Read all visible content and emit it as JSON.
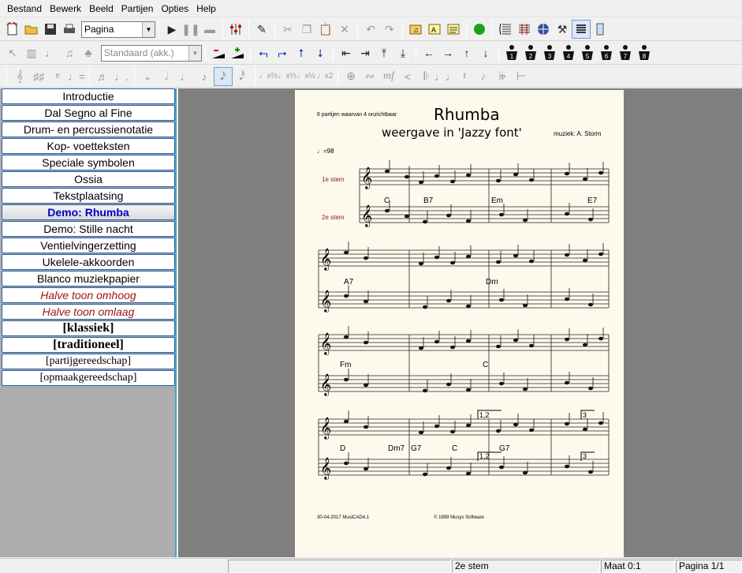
{
  "menu": [
    "Bestand",
    "Bewerk",
    "Beeld",
    "Partijen",
    "Opties",
    "Help"
  ],
  "toolbar": {
    "page_select": "Pagina",
    "style_select": "Standaard (akk.)",
    "figure_labels": [
      "1",
      "2",
      "3",
      "4",
      "5",
      "6",
      "7",
      "8"
    ]
  },
  "sidebar": {
    "items": [
      {
        "label": "Introductie",
        "style": "normal"
      },
      {
        "label": "Dal Segno al Fine",
        "style": "normal"
      },
      {
        "label": "Drum- en percussienotatie",
        "style": "normal"
      },
      {
        "label": "Kop- voetteksten",
        "style": "normal"
      },
      {
        "label": "Speciale symbolen",
        "style": "normal"
      },
      {
        "label": "Ossia",
        "style": "normal"
      },
      {
        "label": "Tekstplaatsing",
        "style": "normal"
      },
      {
        "label": "Demo: Rhumba",
        "style": "active"
      },
      {
        "label": "Demo: Stille nacht",
        "style": "normal"
      },
      {
        "label": "Ventielvingerzetting",
        "style": "normal"
      },
      {
        "label": "Ukelele-akkoorden",
        "style": "normal"
      },
      {
        "label": "Blanco muziekpapier",
        "style": "normal"
      },
      {
        "label": "Halve toon omhoog",
        "style": "red"
      },
      {
        "label": "Halve toon omlaag",
        "style": "red"
      },
      {
        "label": "[klassiek]",
        "style": "bold"
      },
      {
        "label": "[traditioneel]",
        "style": "bold"
      },
      {
        "label": "[partijgereedschap]",
        "style": "serif"
      },
      {
        "label": "[opmaakgereedschap]",
        "style": "serif"
      }
    ]
  },
  "score": {
    "header_note": "6 partijen waarvan 4 onzichtbaar",
    "title": "Rhumba",
    "subtitle": "weergave in 'Jazzy font'",
    "composer": "muziek: A. Storm",
    "tempo": "♩=98",
    "voice1": "1e stem",
    "voice2": "2e stem",
    "chords_sys1": [
      "C",
      "B7",
      "Em",
      "E7"
    ],
    "chords_sys2": [
      "A7",
      "Dm"
    ],
    "chords_sys3": [
      "Fm",
      "C"
    ],
    "chords_sys4": [
      "D",
      "Dm7",
      "G7",
      "C",
      "G7"
    ],
    "volta1": "1,2",
    "volta2": "3",
    "footer_left": "30-04-2017  MusiCAD4.1",
    "footer_right": "© 1999 Musys Software"
  },
  "status": {
    "part": "2e stem",
    "measure": "Maat 0:1",
    "page": "Pagina 1/1"
  }
}
